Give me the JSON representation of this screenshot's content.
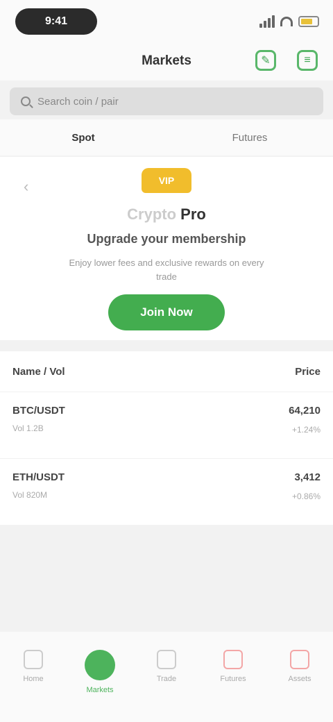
{
  "status": {
    "time": "9:41"
  },
  "header": {
    "title": "Markets"
  },
  "search": {
    "placeholder": "Search coin / pair"
  },
  "tabs": [
    {
      "label": "Spot"
    },
    {
      "label": "Futures"
    }
  ],
  "promo": {
    "badge": "VIP",
    "brand_prefix": "Crypto",
    "brand_suffix": "Pro",
    "title": "Upgrade your membership",
    "subtitle": "Enjoy lower fees and exclusive rewards on every trade",
    "cta_label": "Join Now"
  },
  "list": {
    "col_left": "Name / Vol",
    "col_right": "Price",
    "rows": [
      {
        "name": "BTC/USDT",
        "sub": "Vol 1.2B",
        "amount": "64,210",
        "change": "+1.24%"
      },
      {
        "name": "ETH/USDT",
        "sub": "Vol 820M",
        "amount": "3,412",
        "change": "+0.86%"
      }
    ]
  },
  "nav": [
    {
      "label": "Home"
    },
    {
      "label": "Markets"
    },
    {
      "label": "Trade"
    },
    {
      "label": "Futures"
    },
    {
      "label": "Assets"
    }
  ],
  "colors": {
    "accent": "#43ad4f",
    "gold": "#f1bd2c"
  }
}
